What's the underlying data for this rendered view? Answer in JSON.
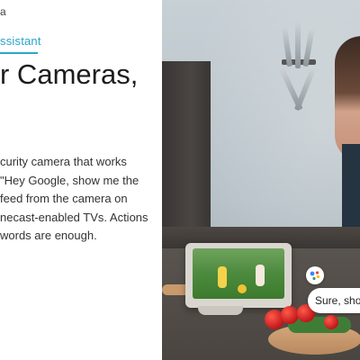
{
  "breadcrumb": "a",
  "eyebrow": "ssistant",
  "headline": "r Cameras,",
  "body_lines": [
    "curity camera that works",
    "\"Hey Google, show me the",
    "feed from the camera on",
    "necast-enabled TVs. Actions",
    "words are enough."
  ],
  "assistant_reply": "Sure, show",
  "colors": {
    "accent": "#2aa6c9"
  },
  "icons": {
    "assistant": "google-assistant-icon"
  }
}
